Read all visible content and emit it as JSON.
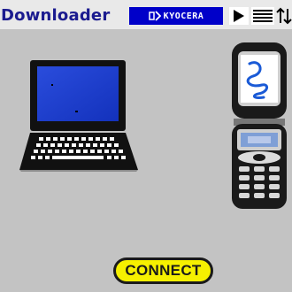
{
  "header": {
    "title": "Downloader",
    "brand": "KYOCERA",
    "brand_logo": "kyocera-logo",
    "play_icon": "play-icon",
    "menu_icon": "menu-icon",
    "sort_icon": "sort-arrows-icon"
  },
  "main": {
    "left_device_icon": "laptop-icon",
    "right_device_icon": "phone-icon",
    "connect_label": "CONNECT"
  },
  "colors": {
    "title": "#1b1b8f",
    "brand_bg": "#0000c9",
    "background": "#c3c3c3",
    "connect_bg": "#f6f000"
  }
}
